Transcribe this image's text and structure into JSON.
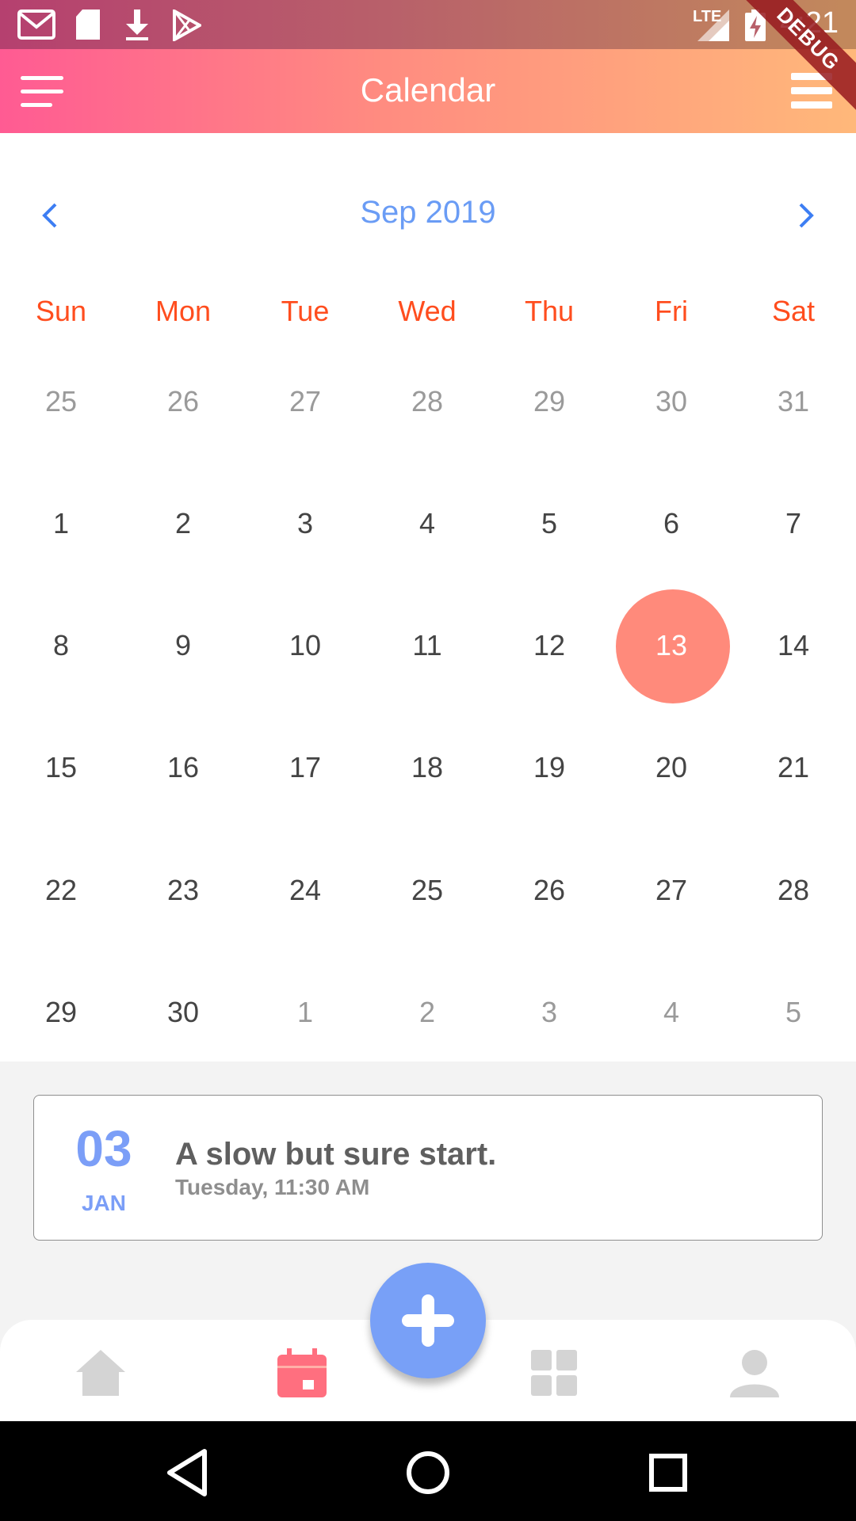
{
  "status_bar": {
    "time": "4:21",
    "network": "LTE"
  },
  "app_bar": {
    "title": "Calendar",
    "debug_banner": "DEBUG"
  },
  "calendar": {
    "month_label": "Sep 2019",
    "weekdays": [
      "Sun",
      "Mon",
      "Tue",
      "Wed",
      "Thu",
      "Fri",
      "Sat"
    ],
    "weeks": [
      [
        "25",
        "26",
        "27",
        "28",
        "29",
        "30",
        "31"
      ],
      [
        "1",
        "2",
        "3",
        "4",
        "5",
        "6",
        "7"
      ],
      [
        "8",
        "9",
        "10",
        "11",
        "12",
        "13",
        "14"
      ],
      [
        "15",
        "16",
        "17",
        "18",
        "19",
        "20",
        "21"
      ],
      [
        "22",
        "23",
        "24",
        "25",
        "26",
        "27",
        "28"
      ],
      [
        "29",
        "30",
        "1",
        "2",
        "3",
        "4",
        "5"
      ]
    ],
    "selected_day": "13",
    "colors": {
      "weekday": "#ff4d1e",
      "selected": "#ff8a7b",
      "month_label": "#6a9cf5"
    }
  },
  "event": {
    "day": "03",
    "month": "JAN",
    "title": "A slow but sure start.",
    "subtitle": "Tuesday, 11:30 AM"
  },
  "bottom_nav": {
    "items": [
      "home-icon",
      "calendar-icon",
      "grid-icon",
      "profile-icon"
    ],
    "fab_icon": "plus-icon",
    "active_color": "#ff6f7f"
  }
}
